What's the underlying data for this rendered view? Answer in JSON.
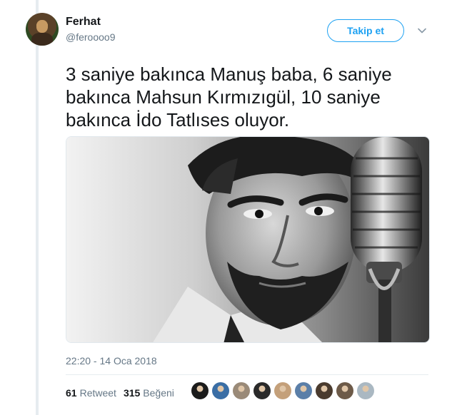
{
  "user": {
    "name": "Ferhat",
    "handle": "@feroooo9"
  },
  "follow_button": {
    "label": "Takip et"
  },
  "tweet": {
    "text": "3 saniye bakınca Manuş baba, 6 saniye bakınca Mahsun Kırmızıgül, 10 saniye bakınca İdo Tatlıses oluyor."
  },
  "timestamp": "22:20 - 14 Oca 2018",
  "stats": {
    "retweets_count": "61",
    "retweets_label": "Retweet",
    "likes_count": "315",
    "likes_label": "Beğeni"
  },
  "likers": [
    {
      "color": "#1b1b1b"
    },
    {
      "color": "#3a6ea5"
    },
    {
      "color": "#9a8a78"
    },
    {
      "color": "#2a2a2a"
    },
    {
      "color": "#c4a07a"
    },
    {
      "color": "#5b7fa8"
    },
    {
      "color": "#4a3b2e"
    },
    {
      "color": "#6d5a48"
    },
    {
      "color": "#aab8c2"
    }
  ],
  "colors": {
    "accent": "#1da1f2",
    "text": "#14171a",
    "muted": "#657786",
    "divider": "#e6ecf0"
  }
}
